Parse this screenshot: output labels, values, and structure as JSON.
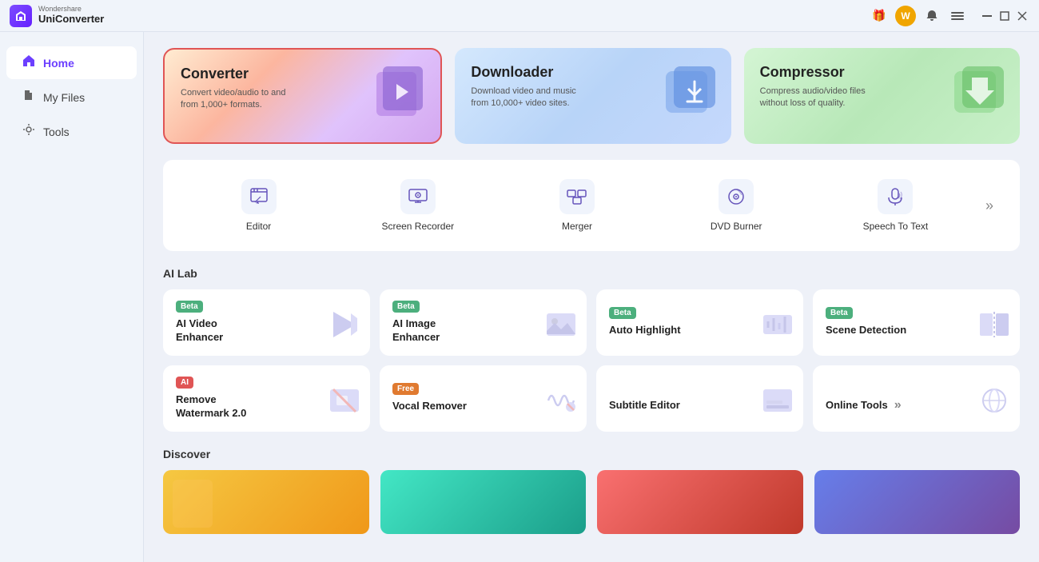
{
  "titlebar": {
    "brand": "Wondershare",
    "name": "UniConverter",
    "logo_letter": "U"
  },
  "sidebar": {
    "items": [
      {
        "id": "home",
        "label": "Home",
        "icon": "🏠",
        "active": true
      },
      {
        "id": "myfiles",
        "label": "My Files",
        "icon": "📄",
        "active": false
      },
      {
        "id": "tools",
        "label": "Tools",
        "icon": "🔧",
        "active": false
      }
    ]
  },
  "hero_cards": [
    {
      "id": "converter",
      "title": "Converter",
      "description": "Convert video/audio to and from 1,000+ formats.",
      "style": "converter"
    },
    {
      "id": "downloader",
      "title": "Downloader",
      "description": "Download video and music from 10,000+ video sites.",
      "style": "downloader"
    },
    {
      "id": "compressor",
      "title": "Compressor",
      "description": "Compress audio/video files without loss of quality.",
      "style": "compressor"
    }
  ],
  "tools": [
    {
      "id": "editor",
      "label": "Editor"
    },
    {
      "id": "screen-recorder",
      "label": "Screen Recorder"
    },
    {
      "id": "merger",
      "label": "Merger"
    },
    {
      "id": "dvd-burner",
      "label": "DVD Burner"
    },
    {
      "id": "speech-to-text",
      "label": "Speech To Text"
    }
  ],
  "ai_lab": {
    "title": "AI Lab",
    "items": [
      {
        "id": "ai-video-enhancer",
        "badge": "Beta",
        "badge_type": "beta",
        "name": "AI Video\nEnhancer"
      },
      {
        "id": "ai-image-enhancer",
        "badge": "Beta",
        "badge_type": "beta",
        "name": "AI Image\nEnhancer"
      },
      {
        "id": "auto-highlight",
        "badge": "Beta",
        "badge_type": "beta",
        "name": "Auto Highlight"
      },
      {
        "id": "scene-detection",
        "badge": "Beta",
        "badge_type": "beta",
        "name": "Scene Detection"
      },
      {
        "id": "remove-watermark",
        "badge": "AI",
        "badge_type": "ai",
        "name": "Remove\nWatermark 2.0"
      },
      {
        "id": "vocal-remover",
        "badge": "Free",
        "badge_type": "free",
        "name": "Vocal Remover"
      },
      {
        "id": "subtitle-editor",
        "badge": "",
        "badge_type": "none",
        "name": "Subtitle Editor"
      },
      {
        "id": "online-tools",
        "badge": "",
        "badge_type": "none",
        "name": "Online Tools"
      }
    ]
  },
  "discover": {
    "title": "Discover",
    "items": [
      {
        "id": "discover-1",
        "style": "discover-card-1"
      },
      {
        "id": "discover-2",
        "style": "discover-card-2"
      },
      {
        "id": "discover-3",
        "style": "discover-card-3"
      },
      {
        "id": "discover-4",
        "style": "discover-card-4"
      }
    ]
  }
}
